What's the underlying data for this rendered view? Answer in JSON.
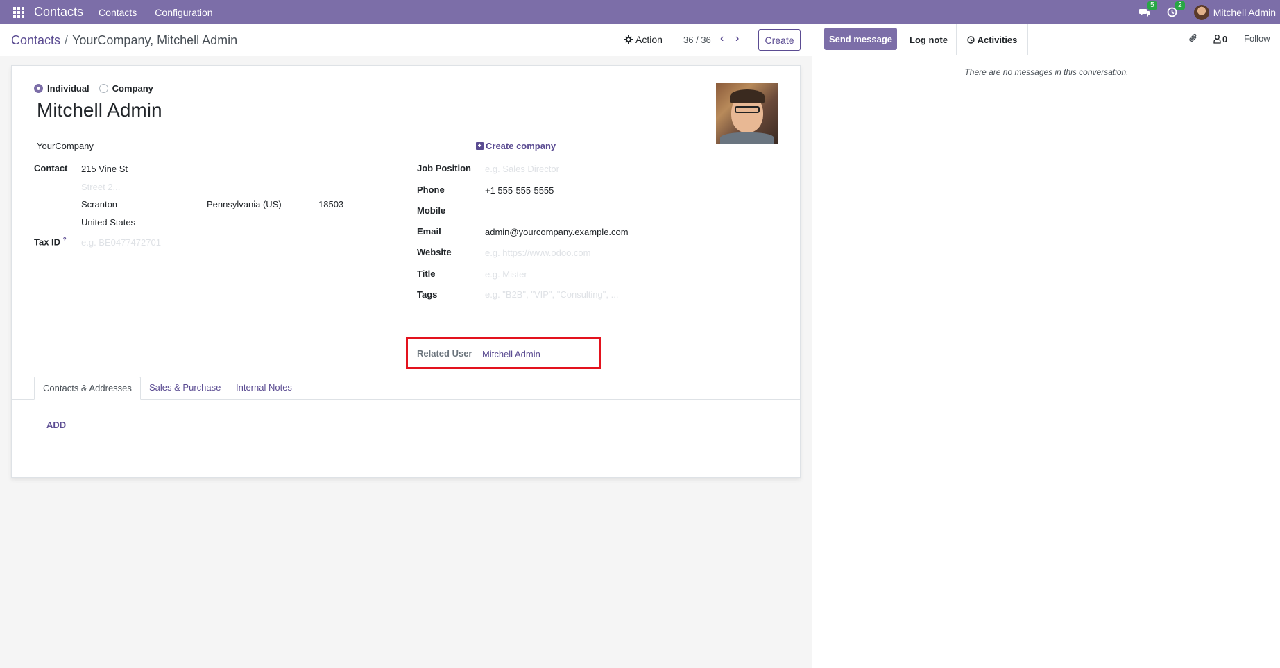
{
  "navbar": {
    "brand": "Contacts",
    "menus": [
      "Contacts",
      "Configuration"
    ],
    "messages_count": "5",
    "activities_count": "2",
    "user_name": "Mitchell Admin"
  },
  "control_panel": {
    "breadcrumb_parent": "Contacts",
    "breadcrumb_sep": "/",
    "breadcrumb_current": "YourCompany, Mitchell Admin",
    "action_label": "Action",
    "pager": "36 / 36",
    "create_label": "Create"
  },
  "form": {
    "type_individual": "Individual",
    "type_company": "Company",
    "name": "Mitchell Admin",
    "company": "YourCompany",
    "create_company": "Create company",
    "contact_label": "Contact",
    "street": "215 Vine St",
    "street2_placeholder": "Street 2...",
    "city": "Scranton",
    "state": "Pennsylvania (US)",
    "zip": "18503",
    "country": "United States",
    "tax_id_label": "Tax ID",
    "tax_id_help": "?",
    "tax_id_placeholder": "e.g. BE0477472701",
    "job_position_label": "Job Position",
    "job_position_placeholder": "e.g. Sales Director",
    "phone_label": "Phone",
    "phone": "+1 555-555-5555",
    "mobile_label": "Mobile",
    "email_label": "Email",
    "email": "admin@yourcompany.example.com",
    "website_label": "Website",
    "website_placeholder": "e.g. https://www.odoo.com",
    "title_label": "Title",
    "title_placeholder": "e.g. Mister",
    "tags_label": "Tags",
    "tags_placeholder": "e.g. \"B2B\", \"VIP\", \"Consulting\", ...",
    "related_user_label": "Related User",
    "related_user": "Mitchell Admin",
    "tabs": [
      "Contacts & Addresses",
      "Sales & Purchase",
      "Internal Notes"
    ],
    "add_label": "ADD"
  },
  "chatter": {
    "send_message": "Send message",
    "log_note": "Log note",
    "activities": "Activities",
    "followers_count": "0",
    "follow": "Follow",
    "empty_text": "There are no messages in this conversation."
  },
  "colors": {
    "brand": "#7c6ea8",
    "link": "#5b4c92",
    "highlight_box": "#e3131e",
    "badge": "#28a745"
  }
}
